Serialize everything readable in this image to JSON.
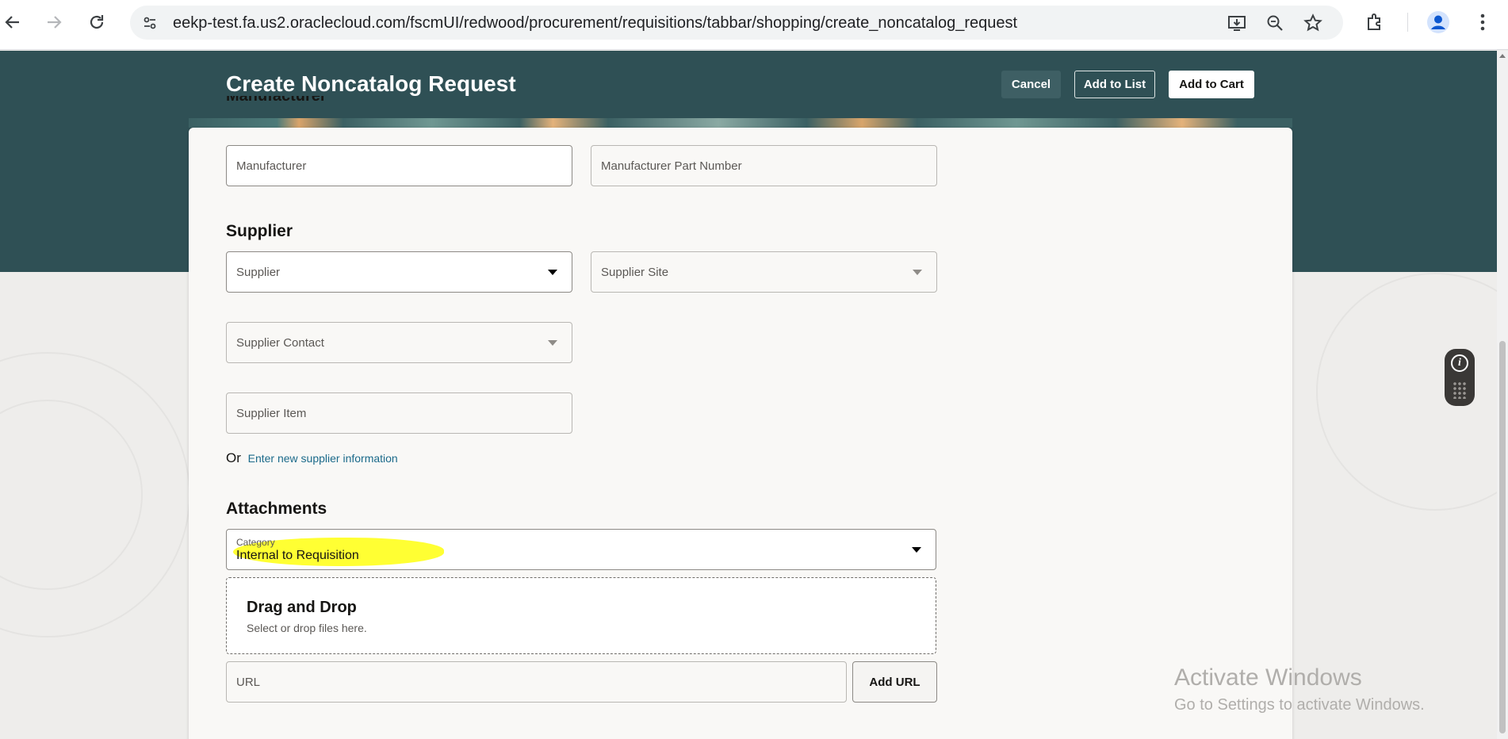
{
  "browser": {
    "url": "eekp-test.fa.us2.oraclecloud.com/fscmUI/redwood/procurement/requisitions/tabbar/shopping/create_noncatalog_request",
    "icons": [
      "back-icon",
      "forward-icon",
      "reload-icon",
      "site-info-icon",
      "install-app-icon",
      "zoom-icon",
      "bookmark-star-icon",
      "extensions-icon",
      "profile-icon",
      "menu-kebab-icon"
    ]
  },
  "header": {
    "title": "Create Noncatalog Request",
    "cancel": "Cancel",
    "add_to_list": "Add to List",
    "add_to_cart": "Add to Cart"
  },
  "form": {
    "cut_section": "Manufacturer",
    "manufacturer": "Manufacturer",
    "manufacturer_part_number": "Manufacturer Part Number",
    "supplier_section": "Supplier",
    "supplier": "Supplier",
    "supplier_site": "Supplier Site",
    "supplier_contact": "Supplier Contact",
    "supplier_item": "Supplier Item",
    "or_text": "Or",
    "new_supplier_link": "Enter new supplier information",
    "attachments_section": "Attachments",
    "category_label": "Category",
    "category_value": "Internal to Requisition",
    "drop_title": "Drag and Drop",
    "drop_sub": "Select or drop files here.",
    "url_placeholder": "URL",
    "add_url": "Add URL"
  },
  "watermark": {
    "line1": "Activate Windows",
    "line2": "Go to Settings to activate Windows."
  },
  "colors": {
    "header_bg": "#2f5055",
    "highlight": "#ffff33",
    "link": "#1b6a8a"
  }
}
